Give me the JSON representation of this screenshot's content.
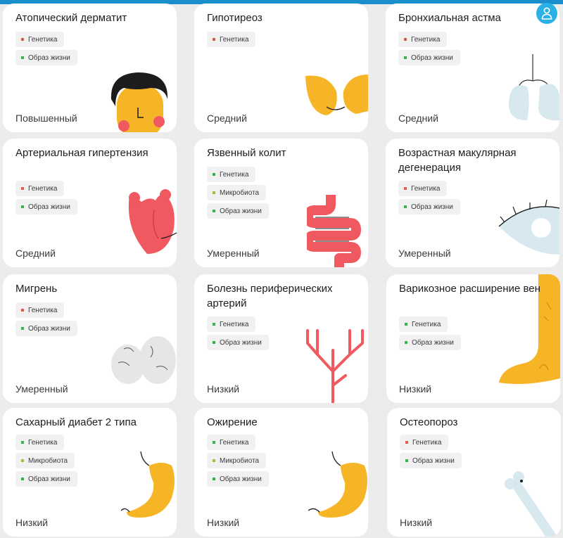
{
  "colors": {
    "accent": "#1a8fcc",
    "avatar_bg": "#2bb0e6",
    "tag_genetics": "#e05a4e",
    "tag_lifestyle": "#35b54a",
    "tag_microbiota": "#9bc43a",
    "illustration_orange": "#f6b526",
    "illustration_red": "#f0595f",
    "illustration_lightblue": "#d8e8ef",
    "illustration_gray": "#e6e6e6"
  },
  "header": {
    "avatar_icon": "user-icon"
  },
  "tag_labels": {
    "genetics": "Генетика",
    "lifestyle": "Образ жизни",
    "microbiota": "Микробиота"
  },
  "cards": [
    {
      "title": "Атопический дерматит",
      "tags": [
        "Генетика",
        "Образ жизни"
      ],
      "level": "Повышенный",
      "icon": "face-icon"
    },
    {
      "title": "Гипотиреоз",
      "tags": [
        "Генетика"
      ],
      "level": "Средний",
      "icon": "thyroid-icon"
    },
    {
      "title": "Бронхиальная астма",
      "tags": [
        "Генетика",
        "Образ жизни"
      ],
      "level": "Средний",
      "icon": "lungs-icon"
    },
    {
      "title": "Артериальная гипертензия",
      "tags": [
        "Генетика",
        "Образ жизни"
      ],
      "level": "Средний",
      "icon": "heart-icon"
    },
    {
      "title": "Язвенный колит",
      "tags": [
        "Генетика",
        "Микробиота",
        "Образ жизни"
      ],
      "level": "Умеренный",
      "icon": "intestine-icon"
    },
    {
      "title": "Возрастная макулярная дегенерация",
      "tags": [
        "Генетика",
        "Образ жизни"
      ],
      "level": "Умеренный",
      "icon": "eye-icon"
    },
    {
      "title": "Мигрень",
      "tags": [
        "Генетика",
        "Образ жизни"
      ],
      "level": "Умеренный",
      "icon": "brain-icon"
    },
    {
      "title": "Болезнь периферических артерий",
      "tags": [
        "Генетика",
        "Образ жизни"
      ],
      "level": "Низкий",
      "icon": "arteries-icon"
    },
    {
      "title": "Варикозное расширение вен",
      "tags": [
        "Генетика",
        "Образ жизни"
      ],
      "level": "Низкий",
      "icon": "leg-icon"
    },
    {
      "title": "Сахарный диабет 2 типа",
      "tags": [
        "Генетика",
        "Микробиота",
        "Образ жизни"
      ],
      "level": "Низкий",
      "icon": "stomach-icon"
    },
    {
      "title": "Ожирение",
      "tags": [
        "Генетика",
        "Микробиота",
        "Образ жизни"
      ],
      "level": "Низкий",
      "icon": "stomach-icon"
    },
    {
      "title": "Остеопороз",
      "tags": [
        "Генетика",
        "Образ жизни"
      ],
      "level": "Низкий",
      "icon": "bone-icon"
    }
  ]
}
